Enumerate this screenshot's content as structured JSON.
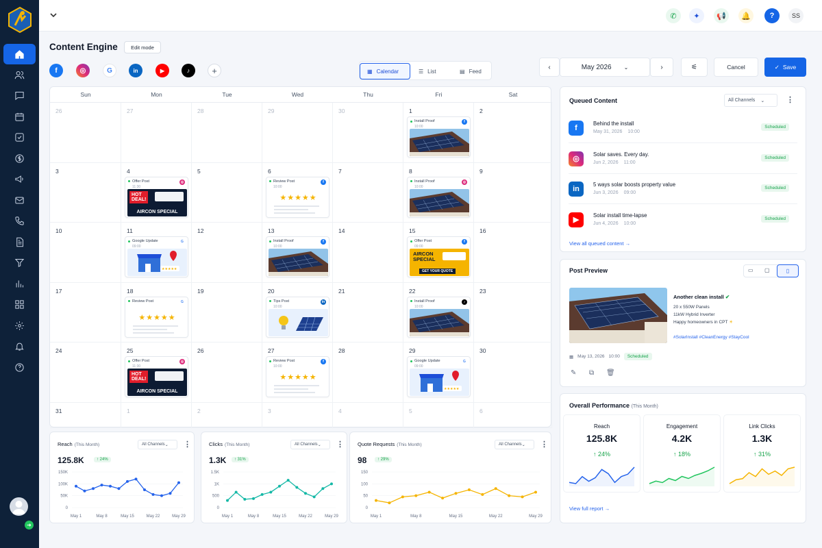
{
  "app": {
    "title": "Content Engine",
    "edit_mode": "Edit mode",
    "user_initials": "SS"
  },
  "view_tabs": [
    "Calendar",
    "List",
    "Feed"
  ],
  "month": "May 2026",
  "buttons": {
    "cancel": "Cancel",
    "save": "Save"
  },
  "weekdays": [
    "Sun",
    "Mon",
    "Tue",
    "Wed",
    "Thu",
    "Fri",
    "Sat"
  ],
  "weeks": [
    [
      "26",
      "27",
      "28",
      "29",
      "30",
      "1",
      "2"
    ],
    [
      "3",
      "4",
      "5",
      "6",
      "7",
      "8",
      "9"
    ],
    [
      "10",
      "11",
      "12",
      "13",
      "14",
      "15",
      "16"
    ],
    [
      "17",
      "18",
      "19",
      "20",
      "21",
      "22",
      "23"
    ],
    [
      "24",
      "25",
      "26",
      "27",
      "28",
      "29",
      "30"
    ],
    [
      "31",
      "1",
      "2",
      "3",
      "4",
      "5",
      "6"
    ]
  ],
  "events": [
    {
      "week": 0,
      "day": 5,
      "title": "Install Proof",
      "time": "10:00",
      "channel": "facebook",
      "image": "solar"
    },
    {
      "week": 1,
      "day": 1,
      "title": "Offer Post",
      "time": "11:30",
      "channel": "instagram",
      "image": "hotdeal"
    },
    {
      "week": 1,
      "day": 3,
      "title": "Review Post",
      "time": "10:00",
      "channel": "facebook",
      "image": "stars"
    },
    {
      "week": 1,
      "day": 5,
      "title": "Install Proof",
      "time": "10:00",
      "channel": "instagram",
      "image": "solar"
    },
    {
      "week": 2,
      "day": 1,
      "title": "Google Update",
      "time": "09:00",
      "channel": "google",
      "image": "store"
    },
    {
      "week": 2,
      "day": 3,
      "title": "Install Proof",
      "time": "10:00",
      "channel": "facebook",
      "image": "solar"
    },
    {
      "week": 2,
      "day": 5,
      "title": "Offer Post",
      "time": "09:00",
      "channel": "facebook",
      "image": "aircon"
    },
    {
      "week": 3,
      "day": 1,
      "title": "Review Post",
      "time": "",
      "channel": "google",
      "image": "stars"
    },
    {
      "week": 3,
      "day": 3,
      "title": "Tips Post",
      "time": "10:00",
      "channel": "linkedin",
      "image": "tips"
    },
    {
      "week": 3,
      "day": 5,
      "title": "Install Proof",
      "time": "10:00",
      "channel": "tiktok",
      "image": "solar"
    },
    {
      "week": 4,
      "day": 1,
      "title": "Offer Post",
      "time": "11:30",
      "channel": "instagram",
      "image": "hotdeal"
    },
    {
      "week": 4,
      "day": 3,
      "title": "Review Post",
      "time": "10:00",
      "channel": "facebook",
      "image": "stars"
    },
    {
      "week": 4,
      "day": 5,
      "title": "Google Update",
      "time": "09:00",
      "channel": "google",
      "image": "store"
    }
  ],
  "creative_text": {
    "hot": "HOT",
    "deal": "DEAL!",
    "aircon_special": "AIRCON SPECIAL",
    "aircon": "AIRCON",
    "special": "SPECIAL",
    "get_quote": "GET YOUR QUOTE",
    "stars": "★★★★★"
  },
  "queued": {
    "title": "Queued Content",
    "filter": "All Channels",
    "items": [
      {
        "title": "Behind the install",
        "date": "May 31, 2026",
        "time": "10:00",
        "status": "Scheduled",
        "channel": "facebook"
      },
      {
        "title": "Solar saves. Every day.",
        "date": "Jun 2, 2026",
        "time": "11:00",
        "status": "Scheduled",
        "channel": "instagram"
      },
      {
        "title": "5 ways solar boosts property value",
        "date": "Jun 3, 2026",
        "time": "09:00",
        "status": "Scheduled",
        "channel": "linkedin"
      },
      {
        "title": "Solar install time-lapse",
        "date": "Jun 4, 2026",
        "time": "10:00",
        "status": "Scheduled",
        "channel": "youtube"
      }
    ],
    "view_all": "View all queued content"
  },
  "preview": {
    "title": "Post Preview",
    "headline": "Another clean install",
    "lines": [
      "20 x 550W Panels",
      "11kW Hybrid Inverter",
      "Happy homeowners in CPT"
    ],
    "hashtags": "#SolarInstall #CleanEnergy #StayCool",
    "date": "May 13, 2026",
    "time": "10:00",
    "status": "Scheduled"
  },
  "performance": {
    "title": "Overall Performance",
    "period": "(This Month)",
    "cards": [
      {
        "label": "Reach",
        "value": "125.8K",
        "change": "24%",
        "color": "#2563eb"
      },
      {
        "label": "Engagement",
        "value": "4.2K",
        "change": "18%",
        "color": "#22c55e"
      },
      {
        "label": "Link Clicks",
        "value": "1.3K",
        "change": "31%",
        "color": "#f5b400"
      }
    ],
    "view_full": "View full report"
  },
  "mini_charts": [
    {
      "title": "Reach",
      "period": "(This Month)",
      "value": "125.8K",
      "change": "24%",
      "filter": "All Channels",
      "color": "#2563eb",
      "yticks": [
        "150K",
        "100K",
        "50K",
        "0"
      ],
      "ymax": 150,
      "values": [
        90,
        70,
        80,
        95,
        90,
        80,
        110,
        120,
        75,
        55,
        50,
        60,
        105
      ]
    },
    {
      "title": "Clicks",
      "period": "(This Month)",
      "value": "1.3K",
      "change": "31%",
      "filter": "All Channels",
      "color": "#14b8a6",
      "yticks": [
        "1.5K",
        "1K",
        "500",
        "0"
      ],
      "ymax": 1500,
      "values": [
        300,
        650,
        350,
        380,
        550,
        650,
        900,
        1150,
        850,
        600,
        450,
        800,
        1000
      ]
    },
    {
      "title": "Quote Requests",
      "period": "(This Month)",
      "value": "98",
      "change": "29%",
      "filter": "All Channels",
      "color": "#f5b400",
      "yticks": [
        "150",
        "100",
        "50",
        "0"
      ],
      "ymax": 150,
      "values": [
        30,
        20,
        45,
        50,
        65,
        40,
        60,
        75,
        55,
        80,
        50,
        45,
        65
      ]
    }
  ],
  "mini_xticks": [
    "May 1",
    "May 8",
    "May 15",
    "May 22",
    "May 29"
  ],
  "perf_spark": [
    [
      30,
      28,
      40,
      32,
      38,
      52,
      45,
      30,
      40,
      44,
      56
    ],
    [
      20,
      25,
      22,
      30,
      26,
      34,
      30,
      36,
      40,
      45,
      52
    ],
    [
      15,
      22,
      24,
      35,
      28,
      42,
      32,
      38,
      30,
      42,
      45
    ]
  ]
}
